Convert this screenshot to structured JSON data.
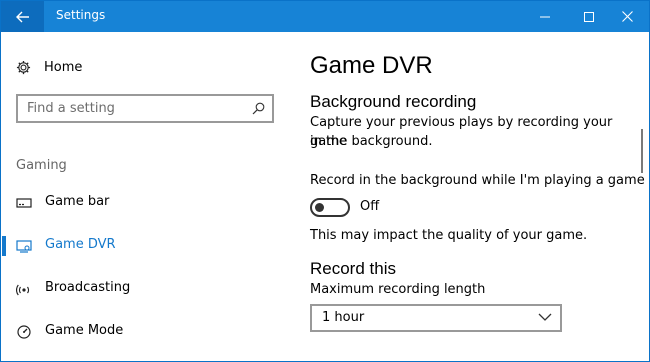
{
  "window": {
    "title": "Settings",
    "controls": {
      "minimize": "minimize-icon",
      "maximize": "maximize-icon",
      "close": "close-icon"
    },
    "accent_color": "#1783d6"
  },
  "sidebar": {
    "home_label": "Home",
    "search_placeholder": "Find a setting",
    "section_title": "Gaming",
    "items": [
      {
        "label": "Game bar",
        "icon": "game-bar-icon",
        "active": false
      },
      {
        "label": "Game DVR",
        "icon": "game-dvr-icon",
        "active": true
      },
      {
        "label": "Broadcasting",
        "icon": "broadcasting-icon",
        "active": false
      },
      {
        "label": "Game Mode",
        "icon": "game-mode-icon",
        "active": false
      }
    ]
  },
  "main": {
    "title": "Game DVR",
    "background_recording": {
      "heading": "Background recording",
      "description_line1": "Capture your previous plays by recording your game",
      "description_line2": "in the background.",
      "toggle_label": "Record in the background while I'm playing a game",
      "toggle_state": "Off",
      "note": "This may impact the quality of your game."
    },
    "record_this": {
      "heading": "Record this",
      "max_length_label": "Maximum recording length",
      "max_length_value": "1 hour"
    }
  }
}
